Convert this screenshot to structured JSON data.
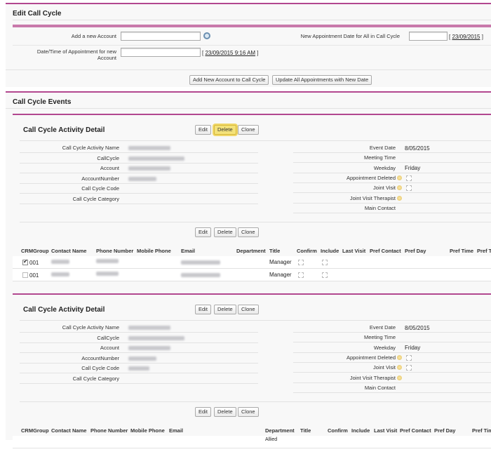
{
  "edit": {
    "title": "Edit Call Cycle",
    "add_account_label": "Add a new Account",
    "add_account_value": "",
    "new_date_label": "New Appointment Date for All in Call Cycle",
    "new_date_value": "",
    "new_date_link": "23/09/2015",
    "datetime_label": "Date/Time of Appointment for new Account",
    "datetime_value": "",
    "datetime_link": "23/09/2015 9:16 AM",
    "add_button": "Add New Account to Call Cycle",
    "update_button": "Update All Appointments with New Date"
  },
  "events": {
    "title": "Call Cycle Events",
    "panels": [
      {
        "title": "Call Cycle Activity Detail",
        "buttons": {
          "edit": "Edit",
          "delete": "Delete",
          "clone": "Clone"
        },
        "left_fields": [
          "Call Cycle Activity Name",
          "CallCycle",
          "Account",
          "AccountNumber",
          "Call Cycle Code",
          "Call Cycle Category"
        ],
        "right_fields": [
          "Event Date",
          "Meeting Time",
          "Weekday",
          "Appointment Deleted",
          "Joint Visit",
          "Joint Visit Therapist",
          "Main Contact"
        ],
        "event_date": "8/05/2015",
        "weekday": "Friday",
        "columns": [
          "CRMGroup",
          "Contact Name",
          "Phone Number",
          "Mobile Phone",
          "Email",
          "Department",
          "Title",
          "Confirm",
          "Include",
          "Last Visit",
          "Pref Contact",
          "Pref Day",
          "Pref Time",
          "Pref T"
        ],
        "rows": [
          {
            "checked": true,
            "group": "001",
            "title": "Manager",
            "department": ""
          },
          {
            "checked": false,
            "group": "001",
            "title": "Manager",
            "department": ""
          }
        ]
      },
      {
        "title": "Call Cycle Activity Detail",
        "buttons": {
          "edit": "Edit",
          "delete": "Delete",
          "clone": "Clone"
        },
        "left_fields": [
          "Call Cycle Activity Name",
          "CallCycle",
          "Account",
          "AccountNumber",
          "Call Cycle Code",
          "Call Cycle Category"
        ],
        "right_fields": [
          "Event Date",
          "Meeting Time",
          "Weekday",
          "Appointment Deleted",
          "Joint Visit",
          "Joint Visit Therapist",
          "Main Contact"
        ],
        "event_date": "8/05/2015",
        "weekday": "Friday",
        "columns": [
          "CRMGroup",
          "Contact Name",
          "Phone Number",
          "Mobile Phone",
          "Email",
          "Department",
          "Title",
          "Confirm",
          "Include",
          "Last Visit",
          "Pref Contact",
          "Pref Day",
          "Pref Time"
        ],
        "rows": [
          {
            "checked": null,
            "group": "",
            "title": "",
            "department": "Allied"
          }
        ]
      }
    ]
  }
}
